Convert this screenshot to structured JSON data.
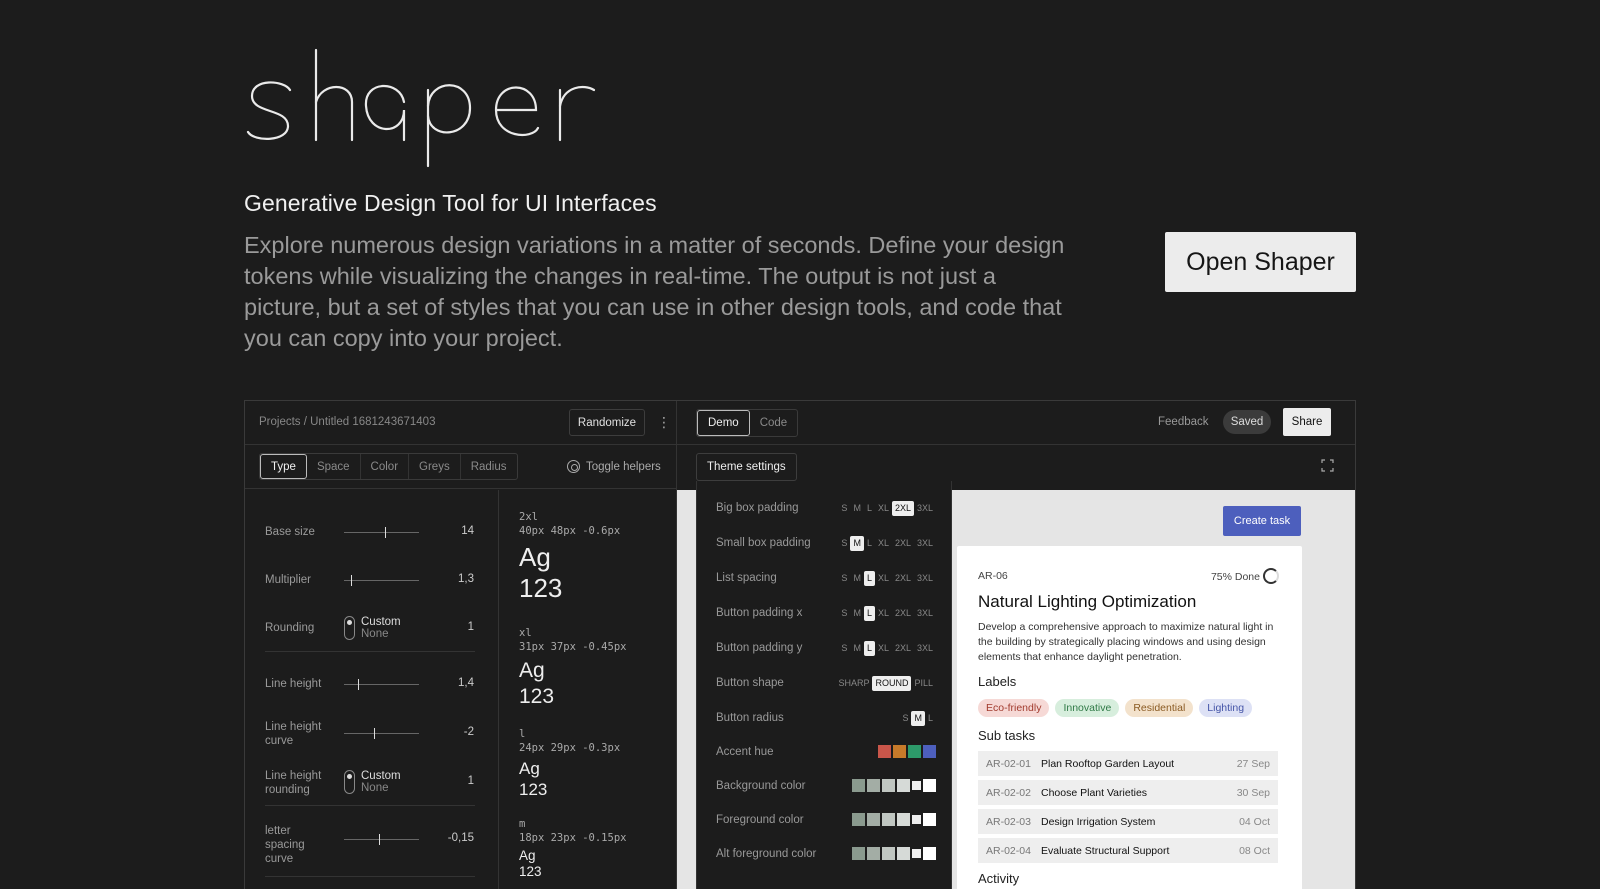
{
  "hero": {
    "logo_text": "shaper",
    "subtitle": "Generative Design Tool for UI Interfaces",
    "description": "Explore numerous design variations in a matter of seconds. Define your design tokens while visualizing the changes in real-time. The output is not just a picture, but a set of styles that you can use in other design tools, and code that you can copy into your project.",
    "cta": "Open Shaper"
  },
  "app": {
    "breadcrumb": "Projects / Untitled 1681243671403",
    "randomize": "Randomize",
    "tabs": [
      "Type",
      "Space",
      "Color",
      "Greys",
      "Radius"
    ],
    "toggle_helpers": "Toggle helpers",
    "view_tabs": [
      "Demo",
      "Code"
    ],
    "feedback": "Feedback",
    "saved": "Saved",
    "share": "Share",
    "theme_settings": "Theme settings",
    "type_controls": {
      "base_size": {
        "label": "Base size",
        "value": "14"
      },
      "multiplier": {
        "label": "Multiplier",
        "value": "1,3"
      },
      "rounding": {
        "label": "Rounding",
        "opt1": "Custom",
        "opt2": "None",
        "value": "1"
      },
      "line_height": {
        "label": "Line height",
        "value": "1,4"
      },
      "line_height_curve": {
        "label": "Line height curve",
        "value": "-2"
      },
      "line_height_rounding": {
        "label": "Line height rounding",
        "opt1": "Custom",
        "opt2": "None",
        "value": "1"
      },
      "letter_spacing_curve": {
        "label": "letter spacing curve",
        "value": "-0,15"
      }
    },
    "type_scale": [
      {
        "name": "2xl",
        "spec": "40px 48px -0.6px",
        "sample1": "Ag",
        "sample2": "123"
      },
      {
        "name": "xl",
        "spec": "31px 37px -0.45px",
        "sample1": "Ag",
        "sample2": "123"
      },
      {
        "name": "l",
        "spec": "24px 29px -0.3px",
        "sample1": "Ag",
        "sample2": "123"
      },
      {
        "name": "m",
        "spec": "18px 23px -0.15px",
        "sample1": "Ag",
        "sample2": "123"
      }
    ],
    "theme": {
      "big_box_padding": {
        "label": "Big box padding",
        "options": [
          "S",
          "M",
          "L",
          "XL",
          "2XL",
          "3XL"
        ],
        "selected": "2XL"
      },
      "small_box_padding": {
        "label": "Small box padding",
        "options": [
          "S",
          "M",
          "L",
          "XL",
          "2XL",
          "3XL"
        ],
        "selected": "M"
      },
      "list_spacing": {
        "label": "List spacing",
        "options": [
          "S",
          "M",
          "L",
          "XL",
          "2XL",
          "3XL"
        ],
        "selected": "L"
      },
      "button_padding_x": {
        "label": "Button padding x",
        "options": [
          "S",
          "M",
          "L",
          "XL",
          "2XL",
          "3XL"
        ],
        "selected": "L"
      },
      "button_padding_y": {
        "label": "Button padding y",
        "options": [
          "S",
          "M",
          "L",
          "XL",
          "2XL",
          "3XL"
        ],
        "selected": "L"
      },
      "button_shape": {
        "label": "Button shape",
        "options": [
          "SHARP",
          "ROUND",
          "PILL"
        ],
        "selected": "ROUND"
      },
      "button_radius": {
        "label": "Button radius",
        "options": [
          "S",
          "M",
          "L"
        ],
        "selected": "M"
      },
      "accent_hue": {
        "label": "Accent hue",
        "colors": [
          "#c9564a",
          "#c77a2a",
          "#2d9a6a",
          "#4d5fbd"
        ]
      },
      "background_color": {
        "label": "Background color",
        "colors": [
          "#8a9a8e",
          "#a3ada5",
          "#c0c6c1",
          "#d6dad7",
          "#eeeeee",
          "#ffffff"
        ]
      },
      "foreground_color": {
        "label": "Foreground color",
        "colors": [
          "#8a9a8e",
          "#a3ada5",
          "#c0c6c1",
          "#d6dad7",
          "#eeeeee",
          "#ffffff"
        ]
      },
      "alt_foreground_color": {
        "label": "Alt foreground color",
        "colors": [
          "#8a9a8e",
          "#a3ada5",
          "#c0c6c1",
          "#d6dad7",
          "#eeeeee",
          "#ffffff"
        ]
      }
    },
    "demo": {
      "create_task": "Create task",
      "task_id": "AR-06",
      "progress_label": "75% Done",
      "progress": 0.75,
      "title": "Natural Lighting Optimization",
      "description": "Develop a comprehensive approach to maximize natural light in the building by strategically placing windows and using design elements that enhance daylight penetration.",
      "labels_heading": "Labels",
      "labels": [
        {
          "text": "Eco-friendly",
          "bg": "#f6d9d6",
          "fg": "#a23b2e"
        },
        {
          "text": "Innovative",
          "bg": "#d7eedd",
          "fg": "#2f7a46"
        },
        {
          "text": "Residential",
          "bg": "#f3e2cc",
          "fg": "#8a5a22"
        },
        {
          "text": "Lighting",
          "bg": "#dde1f5",
          "fg": "#4555a8"
        }
      ],
      "subtasks_heading": "Sub tasks",
      "subtasks": [
        {
          "id": "AR-02-01",
          "name": "Plan Rooftop Garden Layout",
          "date": "27 Sep"
        },
        {
          "id": "AR-02-02",
          "name": "Choose Plant Varieties",
          "date": "30 Sep"
        },
        {
          "id": "AR-02-03",
          "name": "Design Irrigation System",
          "date": "04 Oct"
        },
        {
          "id": "AR-02-04",
          "name": "Evaluate Structural Support",
          "date": "08 Oct"
        }
      ],
      "activity_heading": "Activity"
    }
  }
}
